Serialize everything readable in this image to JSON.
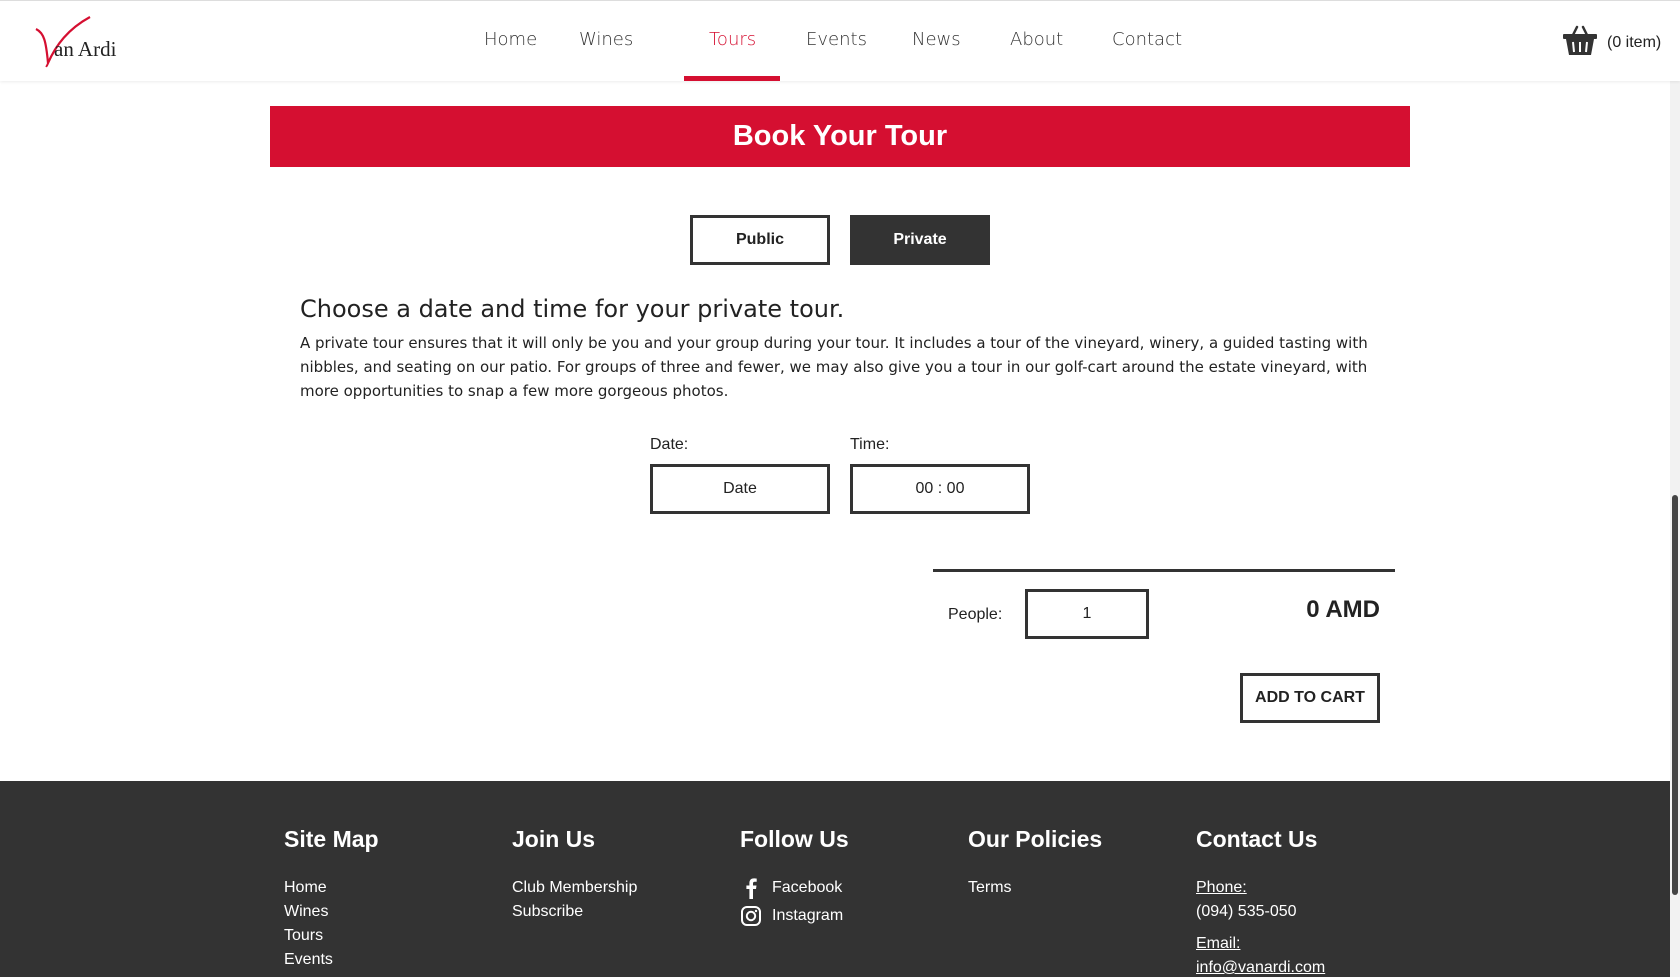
{
  "brand": {
    "logo_text": "an Ardi",
    "accent": "#d50f31"
  },
  "nav": {
    "items": [
      {
        "label": "Home"
      },
      {
        "label": "Wines"
      },
      {
        "label": "Tours"
      },
      {
        "label": "Events"
      },
      {
        "label": "News"
      },
      {
        "label": "About"
      },
      {
        "label": "Contact"
      }
    ],
    "active": "Tours"
  },
  "cart": {
    "label": "(0 item)",
    "icon": "basket-icon"
  },
  "banner": {
    "title": "Book Your Tour"
  },
  "toggle": {
    "public_label": "Public",
    "private_label": "Private",
    "selected": "Private"
  },
  "tour": {
    "heading": "Choose a date and time for your private tour.",
    "description": "A private tour ensures that it will only be you and your group during your tour. It includes a tour of the vineyard, winery, a guided tasting with nibbles, and seating on our patio. For groups of three and fewer, we may also give you a tour in our golf-cart around the estate vineyard, with more opportunities to snap a few more gorgeous photos."
  },
  "form": {
    "date_label": "Date:",
    "date_value": "Date",
    "time_label": "Time:",
    "time_value": "00 : 00",
    "people_label": "People:",
    "people_value": "1",
    "price": "0 AMD",
    "add_to_cart": "ADD TO CART"
  },
  "footer": {
    "sitemap": {
      "title": "Site Map",
      "links": [
        "Home",
        "Wines",
        "Tours",
        "Events"
      ]
    },
    "join": {
      "title": "Join Us",
      "links": [
        "Club Membership",
        "Subscribe"
      ]
    },
    "follow": {
      "title": "Follow Us",
      "links": [
        {
          "label": "Facebook",
          "icon": "facebook-icon"
        },
        {
          "label": "Instagram",
          "icon": "instagram-icon"
        }
      ]
    },
    "policies": {
      "title": "Our Policies",
      "links": [
        "Terms"
      ]
    },
    "contact": {
      "title": "Contact Us",
      "phone_label": "Phone:",
      "phone": "(094) 535-050",
      "email_label": "Email:",
      "email": "info@vanardi.com"
    }
  }
}
